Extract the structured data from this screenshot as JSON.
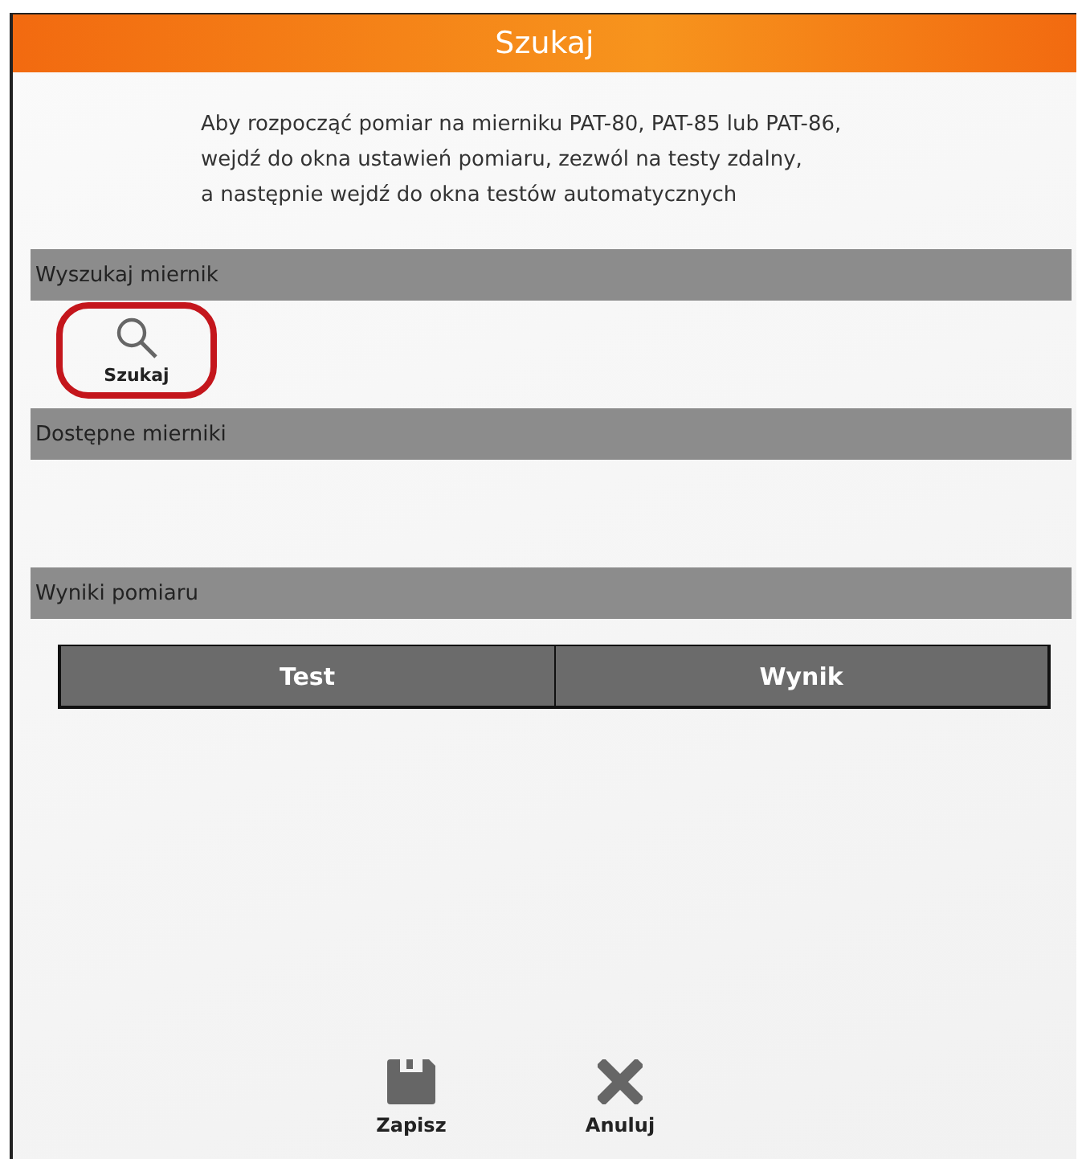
{
  "window": {
    "title": "Szukaj"
  },
  "instructions": [
    "Aby rozpocząć pomiar na mierniku PAT-80, PAT-85 lub PAT-86,",
    "wejdź do okna ustawień pomiaru, zezwól na testy zdalny,",
    "a następnie wejdź do okna testów automatycznych"
  ],
  "search_section": {
    "header": "Wyszukaj miernik",
    "button": {
      "label": "Szukaj",
      "highlighted": true
    }
  },
  "meters_section": {
    "header": "Dostępne mierniki"
  },
  "results_section": {
    "header": "Wyniki pomiaru",
    "table": {
      "columns": [
        "Test",
        "Wynik"
      ]
    }
  },
  "actions": [
    {
      "kind": "save",
      "label": "Zapisz"
    },
    {
      "kind": "cancel",
      "label": "Anuluj"
    }
  ]
}
